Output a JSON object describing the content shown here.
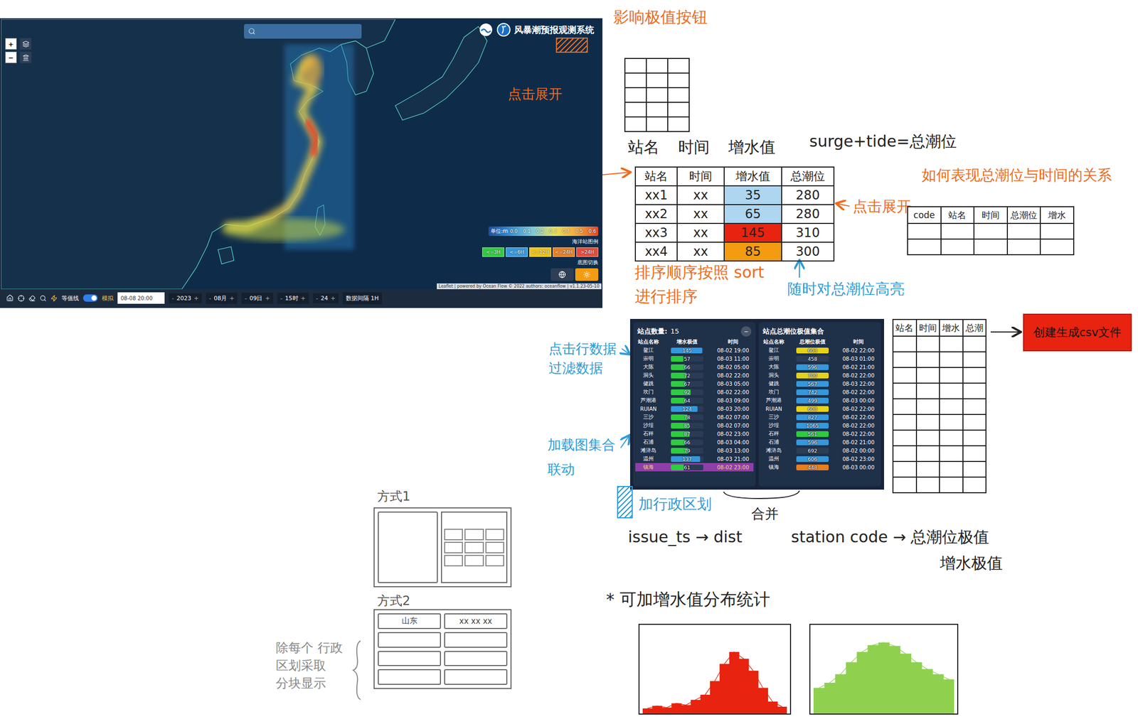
{
  "map_app": {
    "title": "风暴潮预报观测系统",
    "zoom": [
      "+",
      "−"
    ],
    "legend": {
      "unit": "单位:m",
      "ticks": [
        "0.0",
        "0.1",
        "0.2",
        "0.3",
        "0.4",
        "0.5",
        "0.6"
      ]
    },
    "station_legend": {
      "title": "海洋站图例",
      "items": [
        {
          "label": "<=3H",
          "color": "#2ecc40"
        },
        {
          "label": "<=6H",
          "color": "#3498db"
        },
        {
          "label": "<=12H",
          "color": "#f1c40f"
        },
        {
          "label": "<=24H",
          "color": "#e67e22"
        },
        {
          "label": ">24H",
          "color": "#e74c3c"
        }
      ]
    },
    "basemap": {
      "title": "底图切换",
      "options": [
        {
          "kind": "globe",
          "selected": false
        },
        {
          "kind": "sun",
          "selected": true
        }
      ]
    },
    "attribution": "Leaflet | powered by Ocean Flow © 2022 authors: oceanflow | v1.1.23-05-10",
    "toolbar": {
      "contour_label": "等值线",
      "contour_on": true,
      "mode_label": "模拟",
      "datetime": "08-08 20:00",
      "minus": "-",
      "plus": "+",
      "steppers": [
        "2023",
        "08月",
        "09日",
        "15时",
        "24"
      ],
      "interval": "数据间隔 1H"
    }
  },
  "surge_panel": {
    "title": "站点数量:",
    "count": "15",
    "collapse": "−",
    "columns": [
      "站点名称",
      "增水极值",
      "时间"
    ],
    "rows": [
      {
        "name": "鳌江",
        "value": "145",
        "time": "08-02 19:00",
        "level": 0.97,
        "color": "#3498db",
        "selected": false
      },
      {
        "name": "崇明",
        "value": "57",
        "time": "08-03 11:00",
        "level": 0.38,
        "color": "#2ecc40",
        "selected": false
      },
      {
        "name": "大陈",
        "value": "66",
        "time": "08-02 05:00",
        "level": 0.44,
        "color": "#2ecc40",
        "selected": false
      },
      {
        "name": "洞头",
        "value": "72",
        "time": "08-02 22:00",
        "level": 0.48,
        "color": "#2ecc40",
        "selected": false
      },
      {
        "name": "健跳",
        "value": "67",
        "time": "08-03 05:00",
        "level": 0.45,
        "color": "#2ecc40",
        "selected": false
      },
      {
        "name": "坎门",
        "value": "92",
        "time": "08-02 22:00",
        "level": 0.61,
        "color": "#2ecc40",
        "selected": false
      },
      {
        "name": "芦潮港",
        "value": "64",
        "time": "08-03 09:00",
        "level": 0.43,
        "color": "#2ecc40",
        "selected": false
      },
      {
        "name": "RUIAN",
        "value": "124",
        "time": "08-03 20:00",
        "level": 0.83,
        "color": "#3498db",
        "selected": false
      },
      {
        "name": "三沙",
        "value": "78",
        "time": "08-02 07:00",
        "level": 0.52,
        "color": "#2ecc40",
        "selected": false
      },
      {
        "name": "沙埕",
        "value": "85",
        "time": "08-02 07:00",
        "level": 0.57,
        "color": "#2ecc40",
        "selected": false
      },
      {
        "name": "石秤",
        "value": "87",
        "time": "08-02 23:00",
        "level": 0.58,
        "color": "#2ecc40",
        "selected": false
      },
      {
        "name": "石浦",
        "value": "66",
        "time": "08-03 04:00",
        "level": 0.44,
        "color": "#2ecc40",
        "selected": false
      },
      {
        "name": "滩浒岛",
        "value": "79",
        "time": "08-03 13:00",
        "level": 0.53,
        "color": "#2ecc40",
        "selected": false
      },
      {
        "name": "温州",
        "value": "137",
        "time": "08-03 21:00",
        "level": 0.91,
        "color": "#3498db",
        "selected": false
      },
      {
        "name": "镇海",
        "value": "61",
        "time": "08-02 23:00",
        "level": 0.41,
        "color": "#2ecc40",
        "selected": true
      }
    ]
  },
  "tide_panel": {
    "title": "站点总潮位极值集合",
    "columns": [
      "站点名称",
      "总潮位极值",
      "时间"
    ],
    "rows": [
      {
        "name": "鳌江",
        "value": "603",
        "time": "08-02 22:00",
        "level": 1,
        "color": "#e5d21c"
      },
      {
        "name": "崇明",
        "value": "458",
        "time": "08-03 01:00",
        "level": 1,
        "color": "#2c3e55"
      },
      {
        "name": "大陈",
        "value": "596",
        "time": "08-02 21:00",
        "level": 1,
        "color": "#3498db"
      },
      {
        "name": "洞头",
        "value": "700",
        "time": "08-02 22:00",
        "level": 1,
        "color": "#e5d21c"
      },
      {
        "name": "健跳",
        "value": "567",
        "time": "08-03 22:00",
        "level": 1,
        "color": "#3498db"
      },
      {
        "name": "坎门",
        "value": "742",
        "time": "08-02 22:00",
        "level": 1,
        "color": "#3498db"
      },
      {
        "name": "芦潮港",
        "value": "499",
        "time": "08-03 00:00",
        "level": 1,
        "color": "#3498db"
      },
      {
        "name": "RUIAN",
        "value": "608",
        "time": "08-02 22:00",
        "level": 1,
        "color": "#e5d21c"
      },
      {
        "name": "三沙",
        "value": "827",
        "time": "08-02 22:00",
        "level": 1,
        "color": "#3498db"
      },
      {
        "name": "沙埕",
        "value": "1065",
        "time": "08-02 22:00",
        "level": 1,
        "color": "#3498db"
      },
      {
        "name": "石秤",
        "value": "561",
        "time": "08-02 22:00",
        "level": 1,
        "color": "#2ecc40"
      },
      {
        "name": "石浦",
        "value": "596",
        "time": "08-02 21:00",
        "level": 1,
        "color": "#3498db"
      },
      {
        "name": "滩浒岛",
        "value": "692",
        "time": "08-02 00:00",
        "level": 1,
        "color": "#2c3e55"
      },
      {
        "name": "温州",
        "value": "606",
        "time": "08-02 23:00",
        "level": 1,
        "color": "#3498db"
      },
      {
        "name": "镇海",
        "value": "448",
        "time": "08-03 00:00",
        "level": 1,
        "color": "#e67e22"
      }
    ]
  },
  "notes": {
    "extreme_button": "影响极值按钮",
    "click_expand_left": "点击展开",
    "columns_line": [
      "站名",
      "时间",
      "增水值"
    ],
    "formula": "surge+tide=总潮位",
    "sketch_table": {
      "columns": [
        "站名",
        "时间",
        "增水值",
        "总潮位"
      ],
      "rows": [
        {
          "cells": [
            "xx1",
            "xx",
            "35",
            "280"
          ],
          "color": "#aed6f1"
        },
        {
          "cells": [
            "xx2",
            "xx",
            "65",
            "280"
          ],
          "color": "#aed6f1"
        },
        {
          "cells": [
            "xx3",
            "xx",
            "145",
            "310"
          ],
          "color": "#e8230f"
        },
        {
          "cells": [
            "xx4",
            "xx",
            "85",
            "300"
          ],
          "color": "#f39c12"
        }
      ]
    },
    "click_expand_right": "点击展开",
    "sort_note": [
      "排序顺序按照 sort",
      "进行排序"
    ],
    "highlight_note": "随时对总潮位高亮",
    "relation_note": "如何表现总潮位与时间的关系",
    "relation_table": {
      "columns": [
        "code",
        "站名",
        "时间",
        "总潮位",
        "增水"
      ]
    },
    "filter_note": [
      "点击行数据",
      "过滤数据"
    ],
    "chart_note": [
      "加载图集合",
      "联动"
    ],
    "region_note": "加行政区划",
    "merge_note": "合并",
    "mapping": [
      "issue_ts → dist",
      "station code → 总潮位极值",
      "增水极值"
    ],
    "export_table": {
      "columns": [
        "站名",
        "时间",
        "增水",
        "总潮"
      ]
    },
    "csv_button": "创建生成csv文件",
    "layout1": "方式1",
    "layout2": {
      "title": "方式2",
      "cells": [
        "山东",
        "xx xx xx"
      ]
    },
    "layout_note": [
      "除每个 行政",
      "区划采取",
      "分块显示"
    ],
    "stats_note": "* 可加增水值分布统计",
    "charts": [
      {
        "color": "#e8230f",
        "values": [
          6,
          9,
          7,
          12,
          10,
          16,
          22,
          38,
          58,
          72,
          64,
          50,
          30,
          14,
          8
        ]
      },
      {
        "color": "#8fd14f",
        "values": [
          30,
          36,
          46,
          60,
          72,
          80,
          83,
          79,
          70,
          60,
          52,
          46,
          40
        ]
      }
    ]
  }
}
